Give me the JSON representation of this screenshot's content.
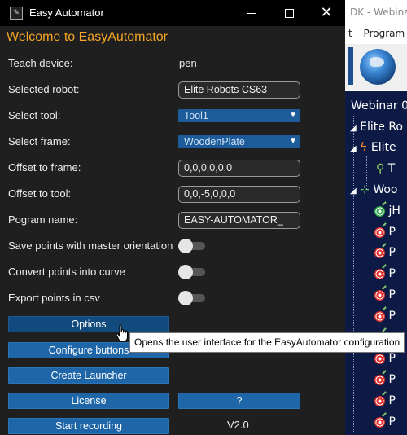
{
  "background_app": {
    "title": "DK - Webinar",
    "menu": [
      "t",
      "Program"
    ],
    "tree": {
      "station": "Webinar 0",
      "robot_root": "Elite Ro",
      "robot": "Elite",
      "tool": "T",
      "frame": "Woo",
      "targets": [
        "jH",
        "P",
        "P",
        "P",
        "P",
        "P",
        "P",
        "P",
        "P",
        "P",
        "P",
        "P"
      ]
    }
  },
  "window": {
    "title": "Easy Automator"
  },
  "welcome": "Welcome to EasyAutomator",
  "form": {
    "teach_device_label": "Teach device:",
    "teach_device_value": "pen",
    "selected_robot_label": "Selected robot:",
    "selected_robot_value": "Elite Robots CS63",
    "select_tool_label": "Select tool:",
    "select_tool_value": "Tool1",
    "select_frame_label": "Select frame:",
    "select_frame_value": "WoodenPlate",
    "offset_frame_label": "Offset to frame:",
    "offset_frame_value": "0,0,0,0,0,0",
    "offset_tool_label": "Offset to tool:",
    "offset_tool_value": "0,0,-5,0,0,0",
    "program_name_label": "Pogram name:",
    "program_name_value": "EASY-AUTOMATOR_",
    "save_master_label": "Save points with master orientation",
    "convert_curve_label": "Convert points into curve",
    "export_csv_label": "Export points in csv",
    "toggles": {
      "save_master": false,
      "convert_curve": false,
      "export_csv": false
    }
  },
  "buttons": {
    "options": "Options",
    "configure": "Configure buttons",
    "create_launcher": "Create Launcher",
    "license": "License",
    "help": "?",
    "start_recording": "Start recording"
  },
  "version": "V2.0",
  "tooltip": "Opens the user interface for the EasyAutomator configuration",
  "colors": {
    "accent": "#f5a623",
    "button": "#1f66a8",
    "select": "#1d5c9a"
  }
}
